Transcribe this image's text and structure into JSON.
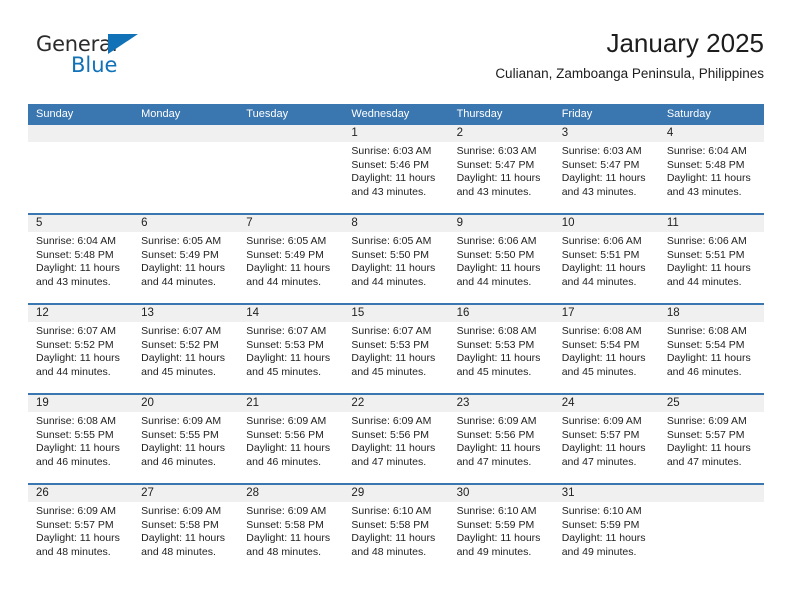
{
  "brand": {
    "name_part1": "General",
    "name_part2": "Blue",
    "triangle_color": "#1172b8"
  },
  "header": {
    "title": "January 2025",
    "subtitle": "Culianan, Zamboanga Peninsula, Philippines"
  },
  "theme": {
    "header_blue": "#3a76b0",
    "row_divider_blue": "#3a76b0",
    "daynum_band": "#f0f0f0",
    "text": "#222222"
  },
  "weekdays": [
    "Sunday",
    "Monday",
    "Tuesday",
    "Wednesday",
    "Thursday",
    "Friday",
    "Saturday"
  ],
  "weeks": [
    [
      {
        "day": "",
        "sunrise": "",
        "sunset": "",
        "daylight": ""
      },
      {
        "day": "",
        "sunrise": "",
        "sunset": "",
        "daylight": ""
      },
      {
        "day": "",
        "sunrise": "",
        "sunset": "",
        "daylight": ""
      },
      {
        "day": "1",
        "sunrise": "Sunrise: 6:03 AM",
        "sunset": "Sunset: 5:46 PM",
        "daylight": "Daylight: 11 hours and 43 minutes."
      },
      {
        "day": "2",
        "sunrise": "Sunrise: 6:03 AM",
        "sunset": "Sunset: 5:47 PM",
        "daylight": "Daylight: 11 hours and 43 minutes."
      },
      {
        "day": "3",
        "sunrise": "Sunrise: 6:03 AM",
        "sunset": "Sunset: 5:47 PM",
        "daylight": "Daylight: 11 hours and 43 minutes."
      },
      {
        "day": "4",
        "sunrise": "Sunrise: 6:04 AM",
        "sunset": "Sunset: 5:48 PM",
        "daylight": "Daylight: 11 hours and 43 minutes."
      }
    ],
    [
      {
        "day": "5",
        "sunrise": "Sunrise: 6:04 AM",
        "sunset": "Sunset: 5:48 PM",
        "daylight": "Daylight: 11 hours and 43 minutes."
      },
      {
        "day": "6",
        "sunrise": "Sunrise: 6:05 AM",
        "sunset": "Sunset: 5:49 PM",
        "daylight": "Daylight: 11 hours and 44 minutes."
      },
      {
        "day": "7",
        "sunrise": "Sunrise: 6:05 AM",
        "sunset": "Sunset: 5:49 PM",
        "daylight": "Daylight: 11 hours and 44 minutes."
      },
      {
        "day": "8",
        "sunrise": "Sunrise: 6:05 AM",
        "sunset": "Sunset: 5:50 PM",
        "daylight": "Daylight: 11 hours and 44 minutes."
      },
      {
        "day": "9",
        "sunrise": "Sunrise: 6:06 AM",
        "sunset": "Sunset: 5:50 PM",
        "daylight": "Daylight: 11 hours and 44 minutes."
      },
      {
        "day": "10",
        "sunrise": "Sunrise: 6:06 AM",
        "sunset": "Sunset: 5:51 PM",
        "daylight": "Daylight: 11 hours and 44 minutes."
      },
      {
        "day": "11",
        "sunrise": "Sunrise: 6:06 AM",
        "sunset": "Sunset: 5:51 PM",
        "daylight": "Daylight: 11 hours and 44 minutes."
      }
    ],
    [
      {
        "day": "12",
        "sunrise": "Sunrise: 6:07 AM",
        "sunset": "Sunset: 5:52 PM",
        "daylight": "Daylight: 11 hours and 44 minutes."
      },
      {
        "day": "13",
        "sunrise": "Sunrise: 6:07 AM",
        "sunset": "Sunset: 5:52 PM",
        "daylight": "Daylight: 11 hours and 45 minutes."
      },
      {
        "day": "14",
        "sunrise": "Sunrise: 6:07 AM",
        "sunset": "Sunset: 5:53 PM",
        "daylight": "Daylight: 11 hours and 45 minutes."
      },
      {
        "day": "15",
        "sunrise": "Sunrise: 6:07 AM",
        "sunset": "Sunset: 5:53 PM",
        "daylight": "Daylight: 11 hours and 45 minutes."
      },
      {
        "day": "16",
        "sunrise": "Sunrise: 6:08 AM",
        "sunset": "Sunset: 5:53 PM",
        "daylight": "Daylight: 11 hours and 45 minutes."
      },
      {
        "day": "17",
        "sunrise": "Sunrise: 6:08 AM",
        "sunset": "Sunset: 5:54 PM",
        "daylight": "Daylight: 11 hours and 45 minutes."
      },
      {
        "day": "18",
        "sunrise": "Sunrise: 6:08 AM",
        "sunset": "Sunset: 5:54 PM",
        "daylight": "Daylight: 11 hours and 46 minutes."
      }
    ],
    [
      {
        "day": "19",
        "sunrise": "Sunrise: 6:08 AM",
        "sunset": "Sunset: 5:55 PM",
        "daylight": "Daylight: 11 hours and 46 minutes."
      },
      {
        "day": "20",
        "sunrise": "Sunrise: 6:09 AM",
        "sunset": "Sunset: 5:55 PM",
        "daylight": "Daylight: 11 hours and 46 minutes."
      },
      {
        "day": "21",
        "sunrise": "Sunrise: 6:09 AM",
        "sunset": "Sunset: 5:56 PM",
        "daylight": "Daylight: 11 hours and 46 minutes."
      },
      {
        "day": "22",
        "sunrise": "Sunrise: 6:09 AM",
        "sunset": "Sunset: 5:56 PM",
        "daylight": "Daylight: 11 hours and 47 minutes."
      },
      {
        "day": "23",
        "sunrise": "Sunrise: 6:09 AM",
        "sunset": "Sunset: 5:56 PM",
        "daylight": "Daylight: 11 hours and 47 minutes."
      },
      {
        "day": "24",
        "sunrise": "Sunrise: 6:09 AM",
        "sunset": "Sunset: 5:57 PM",
        "daylight": "Daylight: 11 hours and 47 minutes."
      },
      {
        "day": "25",
        "sunrise": "Sunrise: 6:09 AM",
        "sunset": "Sunset: 5:57 PM",
        "daylight": "Daylight: 11 hours and 47 minutes."
      }
    ],
    [
      {
        "day": "26",
        "sunrise": "Sunrise: 6:09 AM",
        "sunset": "Sunset: 5:57 PM",
        "daylight": "Daylight: 11 hours and 48 minutes."
      },
      {
        "day": "27",
        "sunrise": "Sunrise: 6:09 AM",
        "sunset": "Sunset: 5:58 PM",
        "daylight": "Daylight: 11 hours and 48 minutes."
      },
      {
        "day": "28",
        "sunrise": "Sunrise: 6:09 AM",
        "sunset": "Sunset: 5:58 PM",
        "daylight": "Daylight: 11 hours and 48 minutes."
      },
      {
        "day": "29",
        "sunrise": "Sunrise: 6:10 AM",
        "sunset": "Sunset: 5:58 PM",
        "daylight": "Daylight: 11 hours and 48 minutes."
      },
      {
        "day": "30",
        "sunrise": "Sunrise: 6:10 AM",
        "sunset": "Sunset: 5:59 PM",
        "daylight": "Daylight: 11 hours and 49 minutes."
      },
      {
        "day": "31",
        "sunrise": "Sunrise: 6:10 AM",
        "sunset": "Sunset: 5:59 PM",
        "daylight": "Daylight: 11 hours and 49 minutes."
      },
      {
        "day": "",
        "sunrise": "",
        "sunset": "",
        "daylight": ""
      }
    ]
  ]
}
